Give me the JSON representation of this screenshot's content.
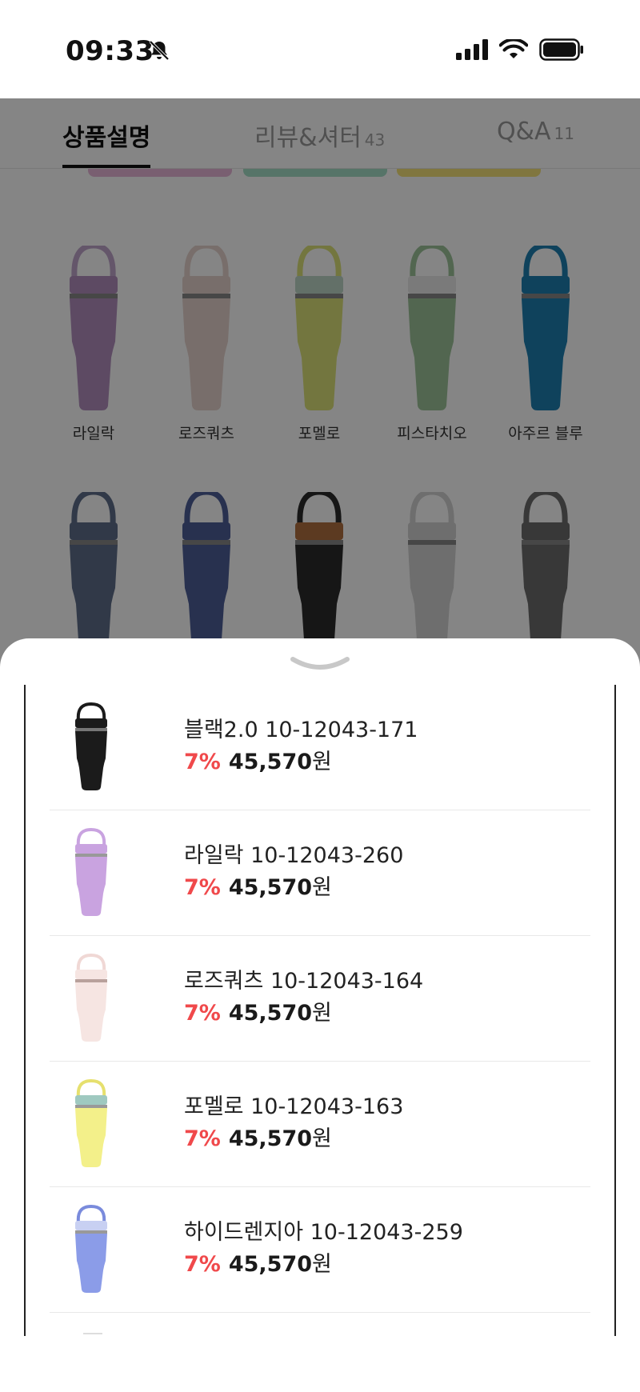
{
  "status_bar": {
    "time": "09:33",
    "icons": [
      "bell-slash-icon",
      "signal-icon",
      "wifi-icon",
      "battery-icon"
    ]
  },
  "tabs": [
    {
      "label": "상품설명",
      "count": "",
      "active": true
    },
    {
      "label": "리뷰&셔터",
      "count": "43",
      "active": false
    },
    {
      "label": "Q&A",
      "count": "11",
      "active": false
    }
  ],
  "color_grid": {
    "row1": [
      "라일락",
      "로즈쿼츠",
      "포멜로",
      "피스타치오",
      "아주르 블루"
    ],
    "row1_colors": [
      "#b28fbf",
      "#e6d4cd",
      "#dde37a",
      "#9dc49a",
      "#1d7fb1"
    ],
    "row2_colors": [
      "#5f6e8a",
      "#4e5e98",
      "#2b2b2b",
      "#d4d4d4",
      "#6b6b6b"
    ]
  },
  "sheet": {
    "items": [
      {
        "name": "블랙2.0 10-12043-171",
        "discount": "7%",
        "price": "45,570",
        "currency": "원",
        "color": "#1b1b1b"
      },
      {
        "name": "라일락 10-12043-260",
        "discount": "7%",
        "price": "45,570",
        "currency": "원",
        "color": "#c9a3e0"
      },
      {
        "name": "로즈쿼츠 10-12043-164",
        "discount": "7%",
        "price": "45,570",
        "currency": "원",
        "color": "#f6e5e2"
      },
      {
        "name": "포멜로 10-12043-163",
        "discount": "7%",
        "price": "45,570",
        "currency": "원",
        "color": "#f3f08a"
      },
      {
        "name": "하이드렌지아 10-12043-259",
        "discount": "7%",
        "price": "45,570",
        "currency": "원",
        "color": "#8b9ce8"
      }
    ]
  }
}
